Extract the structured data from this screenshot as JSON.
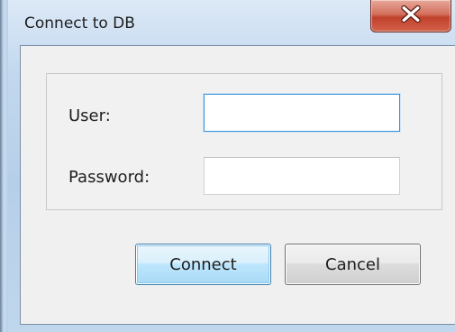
{
  "window": {
    "title": "Connect to DB",
    "close_icon": "close-icon",
    "close_color": "#c7402c"
  },
  "form": {
    "user_label": "User:",
    "user_value": "",
    "password_label": "Password:",
    "password_value": ""
  },
  "buttons": {
    "connect_label": "Connect",
    "cancel_label": "Cancel"
  }
}
